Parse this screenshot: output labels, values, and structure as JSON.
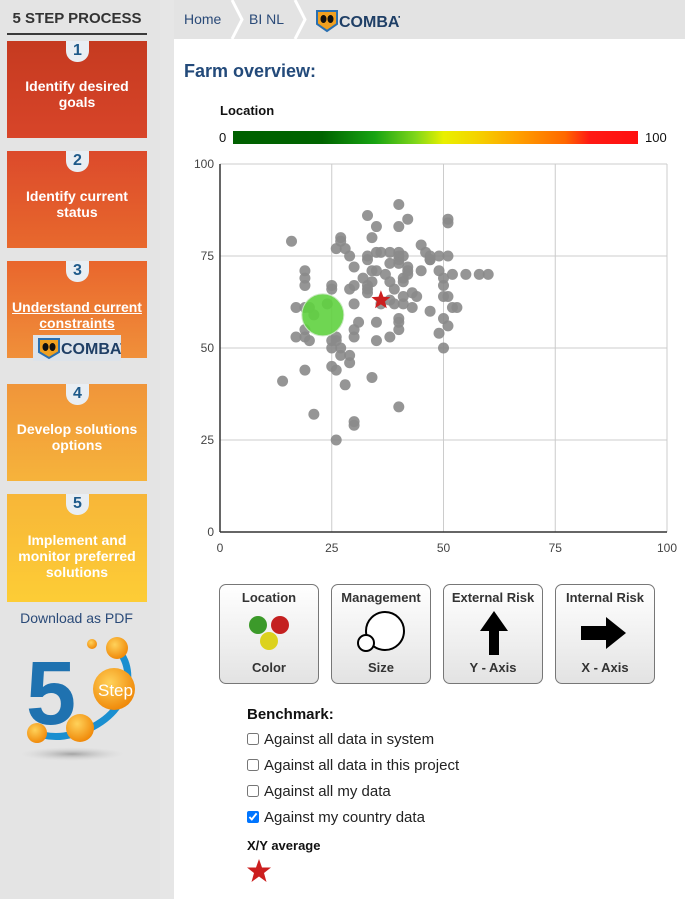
{
  "sidebar": {
    "title": "5 STEP PROCESS",
    "steps": [
      {
        "number": "1",
        "label": "Identify desired goals"
      },
      {
        "number": "2",
        "label": "Identify current status"
      },
      {
        "number": "3",
        "label": "Understand current constraints",
        "badge": "COMBAT"
      },
      {
        "number": "4",
        "label": "Develop solutions options"
      },
      {
        "number": "5",
        "label": "Implement and monitor preferred solutions"
      }
    ],
    "download_label": "Download as PDF",
    "logo": {
      "number": "5",
      "label": "Step"
    }
  },
  "breadcrumb": {
    "items": [
      "Home",
      "BI NL"
    ],
    "brand": "COMBAT"
  },
  "page": {
    "title": "Farm overview:"
  },
  "legend": {
    "title": "Location",
    "min_label": "0",
    "max_label": "100"
  },
  "controls": [
    {
      "title": "Location",
      "caption": "Color",
      "icon": "traffic-dots-icon"
    },
    {
      "title": "Management",
      "caption": "Size",
      "icon": "circles-size-icon"
    },
    {
      "title": "External Risk",
      "caption": "Y - Axis",
      "icon": "arrow-up-icon"
    },
    {
      "title": "Internal Risk",
      "caption": "X - Axis",
      "icon": "arrow-right-icon"
    }
  ],
  "benchmark": {
    "title": "Benchmark:",
    "options": [
      {
        "label": "Against all data in system",
        "checked": false
      },
      {
        "label": "Against all data in this project",
        "checked": false
      },
      {
        "label": "Against all my data",
        "checked": false
      },
      {
        "label": "Against my country data",
        "checked": true
      }
    ],
    "average_title": "X/Y average"
  },
  "colors": {
    "point": "#8a8a8a",
    "highlight": "#5fd13f",
    "average_star": "#cc1f1f",
    "title": "#234a7a"
  },
  "chart_data": {
    "type": "scatter",
    "title": "",
    "xlabel": "Internal Risk",
    "ylabel": "External Risk",
    "xlim": [
      0,
      100
    ],
    "ylim": [
      0,
      100
    ],
    "xticks": [
      0,
      25,
      50,
      75,
      100
    ],
    "yticks": [
      0,
      25,
      50,
      75,
      100
    ],
    "grid": true,
    "color_scale": {
      "label": "Location",
      "min": 0,
      "max": 100
    },
    "points": [
      [
        16,
        79
      ],
      [
        19,
        71
      ],
      [
        19,
        69
      ],
      [
        19,
        67
      ],
      [
        17,
        61
      ],
      [
        19,
        61
      ],
      [
        20,
        61
      ],
      [
        21,
        59
      ],
      [
        24,
        62
      ],
      [
        19,
        55
      ],
      [
        17,
        53
      ],
      [
        25,
        67
      ],
      [
        25,
        66
      ],
      [
        26,
        77
      ],
      [
        27,
        80
      ],
      [
        27,
        79
      ],
      [
        28,
        77
      ],
      [
        29,
        75
      ],
      [
        30,
        72
      ],
      [
        29,
        66
      ],
      [
        30,
        67
      ],
      [
        30,
        62
      ],
      [
        33,
        86
      ],
      [
        34,
        80
      ],
      [
        33,
        75
      ],
      [
        33,
        74
      ],
      [
        34,
        71
      ],
      [
        32,
        69
      ],
      [
        33,
        67
      ],
      [
        33,
        66
      ],
      [
        33,
        65
      ],
      [
        34,
        68
      ],
      [
        35,
        83
      ],
      [
        35,
        76
      ],
      [
        36,
        76
      ],
      [
        35,
        71
      ],
      [
        36,
        62
      ],
      [
        37,
        70
      ],
      [
        38,
        76
      ],
      [
        38,
        73
      ],
      [
        38,
        68
      ],
      [
        38,
        63
      ],
      [
        39,
        66
      ],
      [
        39,
        62
      ],
      [
        40,
        76
      ],
      [
        40,
        75
      ],
      [
        40,
        74
      ],
      [
        40,
        73
      ],
      [
        40,
        83
      ],
      [
        40,
        89
      ],
      [
        41,
        75
      ],
      [
        41,
        68
      ],
      [
        41,
        64
      ],
      [
        41,
        62
      ],
      [
        41,
        69
      ],
      [
        42,
        72
      ],
      [
        42,
        71
      ],
      [
        42,
        70
      ],
      [
        42,
        85
      ],
      [
        43,
        65
      ],
      [
        43,
        61
      ],
      [
        44,
        64
      ],
      [
        45,
        71
      ],
      [
        45,
        78
      ],
      [
        46,
        76
      ],
      [
        47,
        75
      ],
      [
        47,
        74
      ],
      [
        47,
        74
      ],
      [
        47,
        60
      ],
      [
        49,
        71
      ],
      [
        49,
        75
      ],
      [
        50,
        69
      ],
      [
        50,
        64
      ],
      [
        50,
        67
      ],
      [
        51,
        64
      ],
      [
        51,
        84
      ],
      [
        51,
        85
      ],
      [
        51,
        75
      ],
      [
        52,
        61
      ],
      [
        52,
        70
      ],
      [
        50,
        58
      ],
      [
        49,
        54
      ],
      [
        50,
        50
      ],
      [
        51,
        56
      ],
      [
        53,
        61
      ],
      [
        55,
        70
      ],
      [
        19,
        53
      ],
      [
        20,
        52
      ],
      [
        25,
        52
      ],
      [
        26,
        53
      ],
      [
        25,
        50
      ],
      [
        27,
        48
      ],
      [
        29,
        48
      ],
      [
        29,
        46
      ],
      [
        26,
        44
      ],
      [
        25,
        45
      ],
      [
        19,
        44
      ],
      [
        14,
        41
      ],
      [
        28,
        40
      ],
      [
        34,
        42
      ],
      [
        26,
        52
      ],
      [
        27,
        50
      ],
      [
        30,
        55
      ],
      [
        31,
        57
      ],
      [
        30,
        53
      ],
      [
        35,
        52
      ],
      [
        38,
        53
      ],
      [
        35,
        57
      ],
      [
        40,
        55
      ],
      [
        40,
        57
      ],
      [
        40,
        58
      ],
      [
        40,
        34
      ],
      [
        21,
        32
      ],
      [
        30,
        30
      ],
      [
        30,
        29
      ],
      [
        26,
        25
      ],
      [
        58,
        70
      ],
      [
        60,
        70
      ]
    ],
    "highlight_point": {
      "x": 23,
      "y": 59,
      "location_value": 20
    },
    "average": {
      "x": 36,
      "y": 63,
      "marker": "star"
    }
  }
}
